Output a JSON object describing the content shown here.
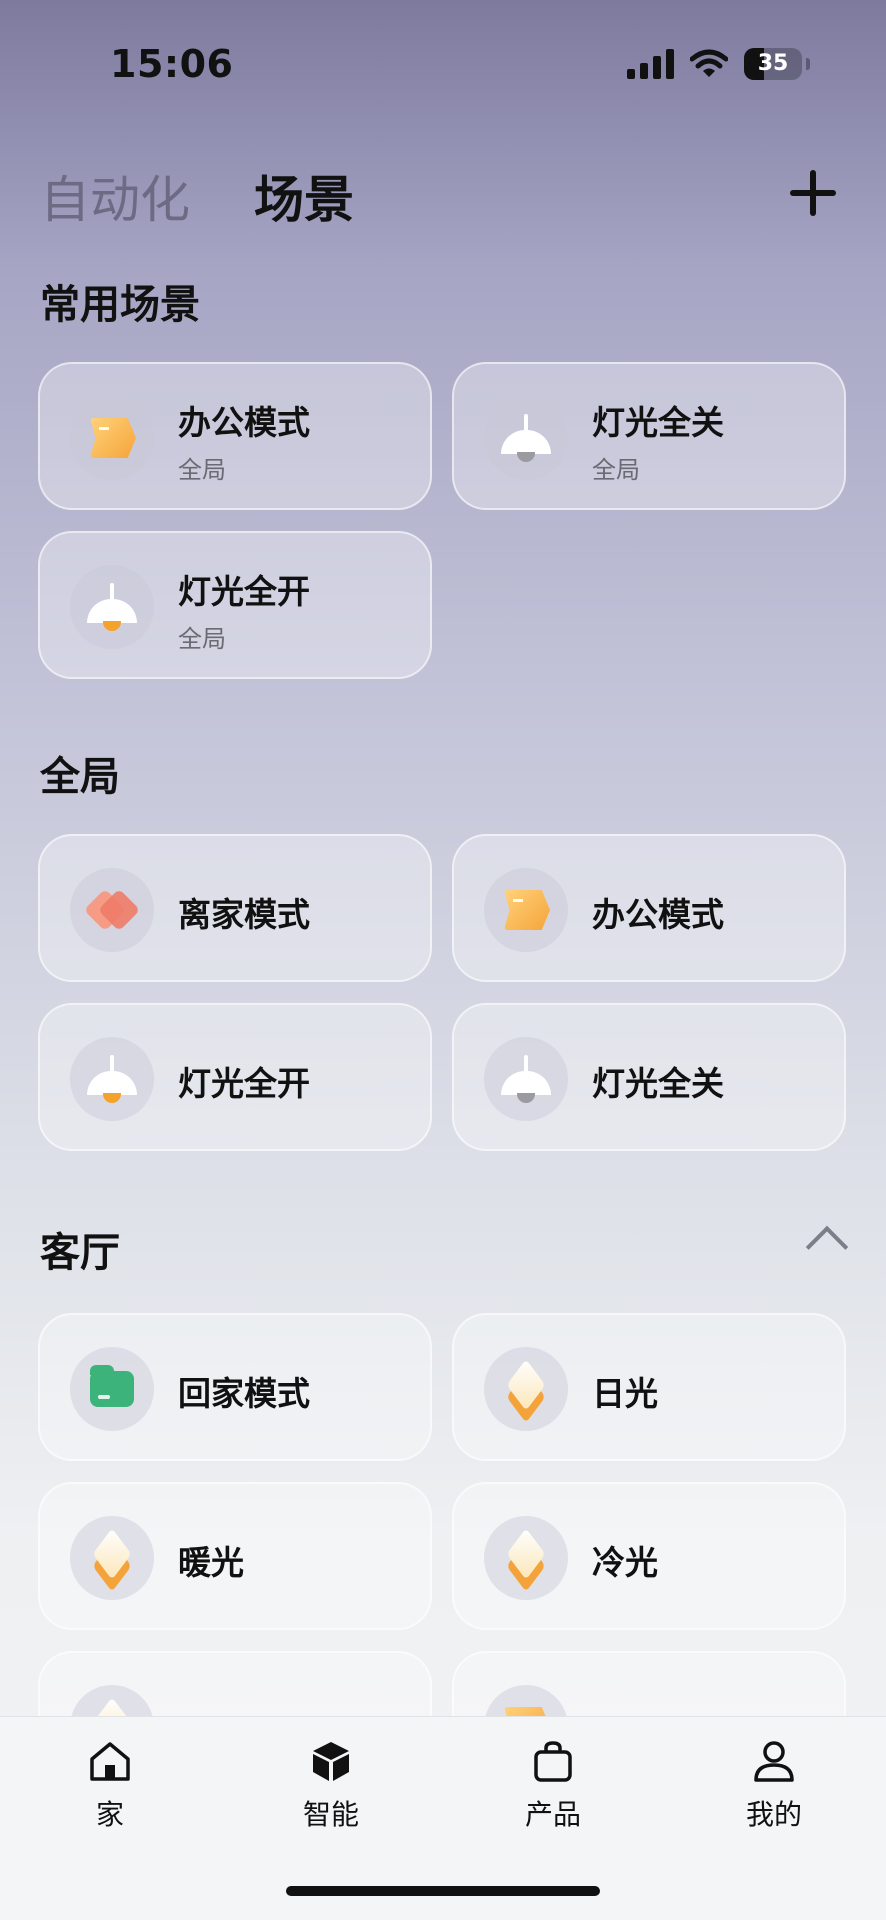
{
  "status_bar": {
    "time": "15:06",
    "battery": "35",
    "battery_level_percent": 35
  },
  "header": {
    "tabs": [
      {
        "label": "自动化",
        "active": false
      },
      {
        "label": "场景",
        "active": true
      }
    ],
    "add_icon": "plus-icon"
  },
  "sections": {
    "frequent": {
      "title": "常用场景",
      "cards": [
        {
          "title": "办公模式",
          "subtitle": "全局",
          "icon": "office-icon"
        },
        {
          "title": "灯光全关",
          "subtitle": "全局",
          "icon": "lamp-off-icon"
        },
        {
          "title": "灯光全开",
          "subtitle": "全局",
          "icon": "lamp-on-icon"
        }
      ]
    },
    "global": {
      "title": "全局",
      "cards": [
        {
          "title": "离家模式",
          "icon": "away-icon"
        },
        {
          "title": "办公模式",
          "icon": "office-icon"
        },
        {
          "title": "灯光全开",
          "icon": "lamp-on-icon"
        },
        {
          "title": "灯光全关",
          "icon": "lamp-off-icon"
        }
      ]
    },
    "living_room": {
      "title": "客厅",
      "collapse_icon": "chevron-up-icon",
      "cards": [
        {
          "title": "回家模式",
          "icon": "home-mode-icon"
        },
        {
          "title": "日光",
          "icon": "layers-icon"
        },
        {
          "title": "暖光",
          "icon": "layers-icon"
        },
        {
          "title": "冷光",
          "icon": "layers-icon"
        }
      ]
    }
  },
  "bottom_nav": [
    {
      "label": "家",
      "icon": "house-icon"
    },
    {
      "label": "智能",
      "icon": "cube-icon"
    },
    {
      "label": "产品",
      "icon": "bag-icon"
    },
    {
      "label": "我的",
      "icon": "person-icon"
    }
  ],
  "colors": {
    "accent_orange": "#f5a22d",
    "green": "#3bb37a",
    "coral": "#ee7c68"
  }
}
